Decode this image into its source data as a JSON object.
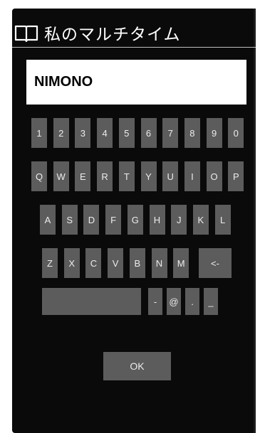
{
  "header": {
    "title": "私のマルチタイム",
    "icon": "open-book-icon"
  },
  "input": {
    "value": "NIMONO"
  },
  "keyboard": {
    "rows": [
      [
        "1",
        "2",
        "3",
        "4",
        "5",
        "6",
        "7",
        "8",
        "9",
        "0"
      ],
      [
        "Q",
        "W",
        "E",
        "R",
        "T",
        "Y",
        "U",
        "I",
        "O",
        "P"
      ],
      [
        "A",
        "S",
        "D",
        "F",
        "G",
        "H",
        "J",
        "K",
        "L"
      ],
      [
        "Z",
        "X",
        "C",
        "V",
        "B",
        "N",
        "M",
        "<-"
      ],
      [
        "",
        "-",
        "@",
        ".",
        "_"
      ]
    ]
  },
  "ok_label": "OK"
}
